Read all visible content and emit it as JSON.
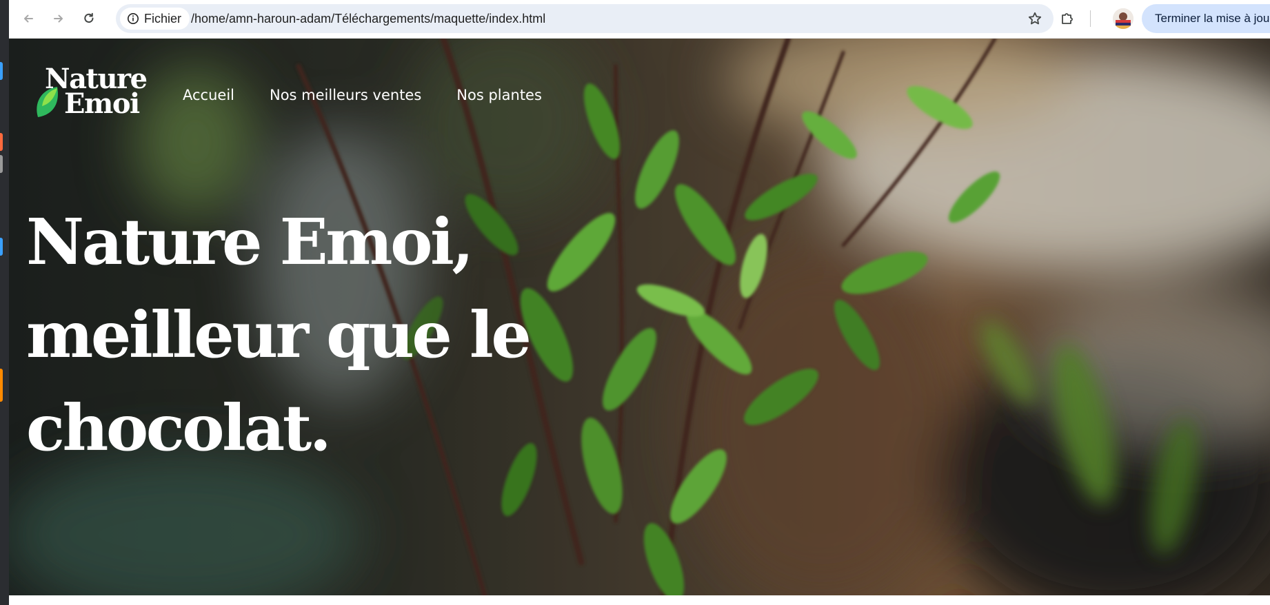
{
  "browser": {
    "chip_label": "Fichier",
    "url": "/home/amn-haroun-adam/Téléchargements/maquette/index.html",
    "update_button": "Terminer la mise à jour"
  },
  "site": {
    "logo": {
      "line1": "Nature",
      "line2": "Emoi"
    },
    "nav": [
      "Accueil",
      "Nos meilleurs ventes",
      "Nos plantes"
    ],
    "headline": [
      "Nature Emoi,",
      "meilleur que le",
      "chocolat."
    ]
  },
  "colors": {
    "accent": "#d3e3fd",
    "omnibox": "#e9eef6",
    "leaf_green": "#2fb85d",
    "leaf_light": "#8ee04a",
    "text_on_hero": "#ffffff"
  },
  "icons": {
    "toolbar": [
      "back-arrow-icon",
      "forward-arrow-icon",
      "reload-icon",
      "info-icon",
      "star-icon",
      "extensions-icon",
      "kebab-menu-icon"
    ],
    "logo": "leaf-icon"
  }
}
